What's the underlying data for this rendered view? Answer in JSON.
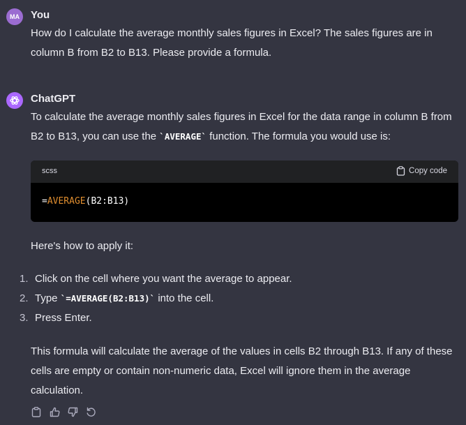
{
  "user_message": {
    "avatar_initials": "MA",
    "author": "You",
    "text": "How do I calculate the average monthly sales figures in Excel? The sales figures are in column B from B2 to B13. Please provide a formula."
  },
  "assistant_message": {
    "author": "ChatGPT",
    "intro_before_code": "To calculate the average monthly sales figures in Excel for the data range in column B from B2 to B13, you can use the ",
    "intro_inline_code": "`AVERAGE`",
    "intro_after_code": " function. The formula you would use is:",
    "code_block": {
      "language": "scss",
      "copy_label": "Copy code",
      "prefix": "=",
      "function_name": "AVERAGE",
      "args": "(B2:B13)"
    },
    "apply_heading": "Here's how to apply it:",
    "steps": [
      {
        "number": "1.",
        "text": "Click on the cell where you want the average to appear."
      },
      {
        "number": "2.",
        "text_before": "Type ",
        "code": "`=AVERAGE(B2:B13)`",
        "text_after": " into the cell."
      },
      {
        "number": "3.",
        "text": "Press Enter."
      }
    ],
    "closing": "This formula will calculate the average of the values in cells B2 through B13. If any of these cells are empty or contain non-numeric data, Excel will ignore them in the average calculation."
  },
  "actions": {
    "icons": [
      "clipboard-icon",
      "thumbs-up-icon",
      "thumbs-down-icon",
      "regenerate-icon"
    ]
  },
  "colors": {
    "background": "#343541",
    "text": "#ececf1",
    "user_avatar": "#9b6cd1",
    "assistant_avatar": "#ab68ff",
    "code_function": "#df8d2f"
  }
}
